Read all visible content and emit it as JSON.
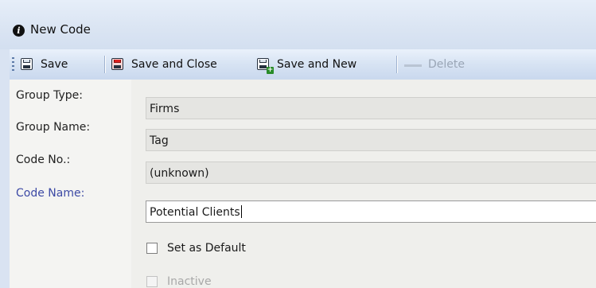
{
  "window": {
    "title": "New Code",
    "app_icon": "info-logo-icon"
  },
  "toolbar": {
    "save_label": "Save",
    "save_close_label": "Save and Close",
    "save_new_label": "Save and New",
    "delete_label": "Delete"
  },
  "form": {
    "group_type": {
      "label": "Group Type:",
      "value": "Firms"
    },
    "group_name": {
      "label": "Group Name:",
      "value": "Tag"
    },
    "code_no": {
      "label": "Code No.:",
      "value": "(unknown)"
    },
    "code_name": {
      "label": "Code Name:",
      "value": "Potential Clients"
    },
    "set_default": {
      "label": "Set as Default",
      "checked": false
    },
    "inactive": {
      "label": "Inactive",
      "checked": false,
      "disabled": true
    }
  },
  "colors": {
    "required_label": "#3d4aa5",
    "toolbar_bg": "#d7e3f3",
    "window_bg": "#d9e3f2"
  }
}
